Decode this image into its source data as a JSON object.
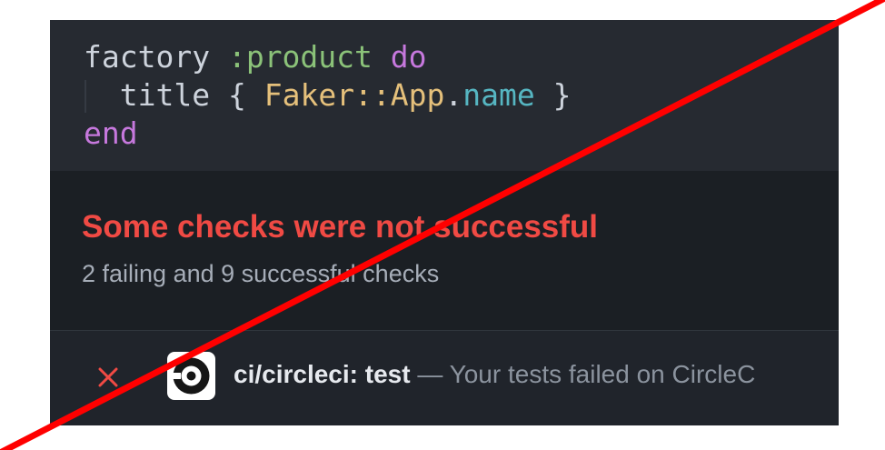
{
  "code": {
    "line1": {
      "keyword": "factory",
      "symbol": ":product",
      "do": "do"
    },
    "line2": {
      "method": "title",
      "open_brace": "{",
      "constant": "Faker::App",
      "dot": ".",
      "call": "name",
      "close_brace": "}"
    },
    "line3": {
      "end": "end"
    }
  },
  "status": {
    "title": "Some checks were not successful",
    "subtitle": "2 failing and 9 successful checks"
  },
  "checks": [
    {
      "state_icon": "x-icon",
      "logo_icon": "circleci-icon",
      "name": "ci/circleci: test",
      "separator": " — ",
      "description": "Your tests failed on CircleC"
    }
  ],
  "colors": {
    "failure": "#f04a44",
    "overlay_line": "#ff0000"
  }
}
